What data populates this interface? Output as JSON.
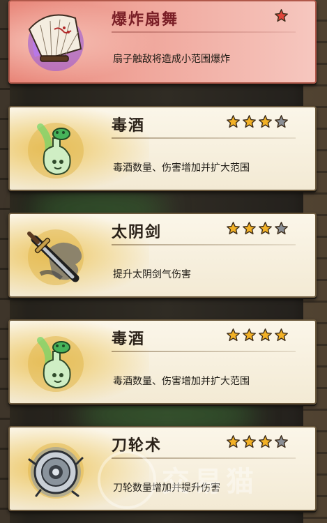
{
  "skills": [
    {
      "name": "爆炸扇舞",
      "stars": 1,
      "max_stars": 1,
      "description": "扇子触敌将造成小范围爆炸",
      "icon": "folding-fan-icon",
      "theme": "red"
    },
    {
      "name": "毒酒",
      "stars": 3,
      "max_stars": 4,
      "description": "毒酒数量、伤害增加并扩大范围",
      "icon": "poison-wine-gourd-icon",
      "theme": "gold"
    },
    {
      "name": "太阴剑",
      "stars": 3,
      "max_stars": 4,
      "description": "提升太阴剑气伤害",
      "icon": "yin-sword-icon",
      "theme": "gold"
    },
    {
      "name": "毒酒",
      "stars": 4,
      "max_stars": 4,
      "description": "毒酒数量、伤害增加并扩大范围",
      "icon": "poison-wine-gourd-icon",
      "theme": "gold"
    },
    {
      "name": "刀轮术",
      "stars": 3,
      "max_stars": 4,
      "description": "刀轮数量增加并提升伤害",
      "icon": "blade-wheel-icon",
      "theme": "gold"
    }
  ],
  "watermark": {
    "text": "交易猫"
  },
  "colors": {
    "star_filled": "#f2b126",
    "star_empty": "#8b8f95",
    "red_card": "#e9877a",
    "gold_card": "#f3ead4"
  }
}
